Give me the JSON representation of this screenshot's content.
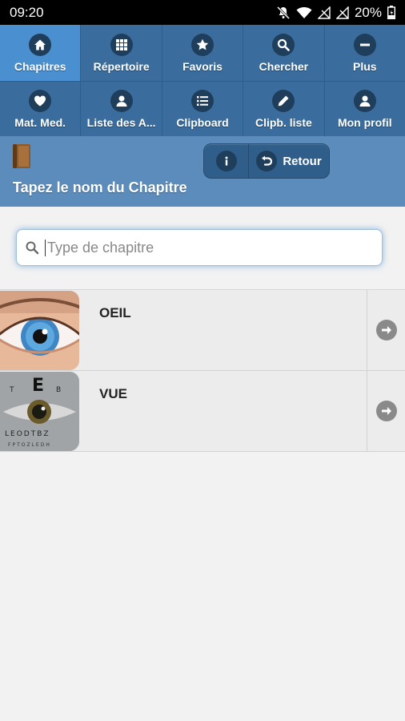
{
  "status_bar": {
    "time": "09:20",
    "battery": "20%"
  },
  "nav": {
    "items": [
      {
        "label": "Chapitres",
        "icon": "home-icon",
        "active": true
      },
      {
        "label": "Répertoire",
        "icon": "grid-icon",
        "active": false
      },
      {
        "label": "Favoris",
        "icon": "star-icon",
        "active": false
      },
      {
        "label": "Chercher",
        "icon": "search-icon",
        "active": false
      },
      {
        "label": "Plus",
        "icon": "minus-icon",
        "active": false
      },
      {
        "label": "Mat. Med.",
        "icon": "heart-icon",
        "active": false
      },
      {
        "label": "Liste des A...",
        "icon": "user-icon",
        "active": false
      },
      {
        "label": "Clipboard",
        "icon": "list-icon",
        "active": false
      },
      {
        "label": "Clipb. liste",
        "icon": "pencil-icon",
        "active": false
      },
      {
        "label": "Mon profil",
        "icon": "user-icon",
        "active": false
      }
    ]
  },
  "header": {
    "title": "Tapez le nom du Chapitre",
    "back_label": "Retour"
  },
  "search": {
    "placeholder": "Type de chapitre",
    "value": ""
  },
  "chapters": [
    {
      "title": "OEIL",
      "image": "eye-photo"
    },
    {
      "title": "VUE",
      "image": "eye-chart-photo"
    }
  ],
  "colors": {
    "nav_bg": "#3a6d9d",
    "nav_active": "#4a8fcf",
    "header_bg": "#5b8cbc",
    "list_bg": "#ececec"
  }
}
